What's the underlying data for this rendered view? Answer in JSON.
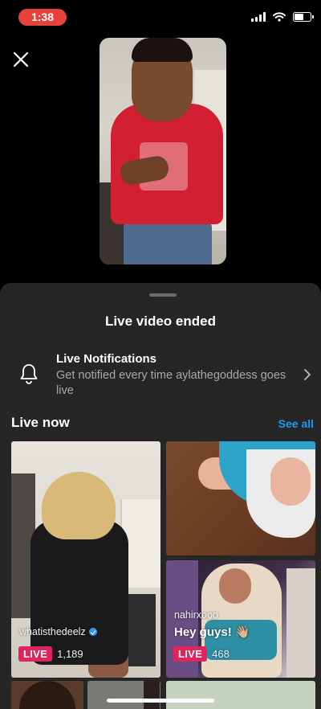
{
  "status_bar": {
    "time": "1:38",
    "icons": [
      "signal-icon",
      "wifi-icon",
      "battery-icon"
    ],
    "time_pill_color": "#e8413c"
  },
  "header": {
    "close_icon": "close-icon"
  },
  "sheet": {
    "title": "Live video ended",
    "notification": {
      "title": "Live Notifications",
      "subtitle": "Get notified every time aylathegoddess goes live",
      "icon": "bell-icon"
    },
    "live_now": {
      "label": "Live now",
      "see_all": "See all",
      "see_all_color": "#1a9bf0"
    },
    "streams": [
      {
        "username": "whatisthedeelz",
        "verified": true,
        "caption": "",
        "badge": "LIVE",
        "viewers": "1,189"
      },
      {
        "username": "",
        "verified": false,
        "caption": "",
        "badge": "",
        "viewers": ""
      },
      {
        "username": "nahirxooo",
        "verified": false,
        "caption": "Hey guys! 👋🏼",
        "badge": "LIVE",
        "viewers": "468"
      }
    ],
    "badge_color": "#e0245e"
  }
}
